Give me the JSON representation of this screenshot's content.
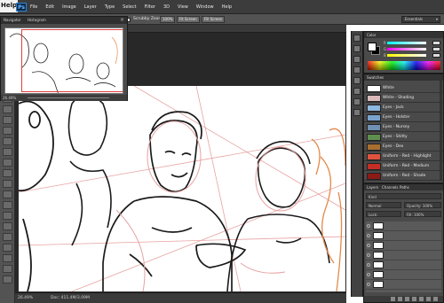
{
  "app": {
    "partial_menu_label": "Help",
    "logo": "Ps"
  },
  "menu": {
    "items": [
      "File",
      "Edit",
      "Image",
      "Layer",
      "Type",
      "Select",
      "Filter",
      "3D",
      "View",
      "Window",
      "Help"
    ]
  },
  "options_bar": {
    "scrubby_zoom_label": "Scrubby Zoom",
    "btn_100": "100%",
    "btn_fit_screen": "Fit Screen",
    "btn_fill_screen": "Fill Screen",
    "workspace": "Essentials"
  },
  "navigator": {
    "tab_navigator": "Navigator",
    "tab_histogram": "Histogram",
    "zoom": "26.49%"
  },
  "status_bar": {
    "zoom": "26.49%",
    "doc_info": "Doc: 411.4M/3.09M"
  },
  "color_panel": {
    "title": "Color",
    "foreground": "#ffffff",
    "background": "#000000",
    "channels": [
      "R",
      "G",
      "B"
    ]
  },
  "swatches_panel": {
    "title": "Swatches",
    "items": [
      {
        "label": "White",
        "color": "#ffffff"
      },
      {
        "label": "White - Shading",
        "color": "#d9b9b9"
      },
      {
        "label": "Eyes - Jack",
        "color": "#8db8e0"
      },
      {
        "label": "Eyes - Holster",
        "color": "#7aa3cf"
      },
      {
        "label": "Eyes - Nursey",
        "color": "#6f8fb3"
      },
      {
        "label": "Eyes - Shitty",
        "color": "#5f8f4e"
      },
      {
        "label": "Eyes - Dex",
        "color": "#a86e2f"
      },
      {
        "label": "Uniform - Red - Highlight",
        "color": "#e0523e"
      },
      {
        "label": "Uniform - Red - Medium",
        "color": "#c62e25"
      },
      {
        "label": "Uniform - Red - Shade",
        "color": "#8c1a17"
      }
    ]
  },
  "layers_panel": {
    "tabs": [
      "Layers",
      "Channels",
      "Paths"
    ],
    "kind": "Kind",
    "blend_mode": "Normal",
    "opacity_label": "Opacity: 100%",
    "lock_label": "Lock:",
    "fill_label": "Fill: 100%"
  }
}
